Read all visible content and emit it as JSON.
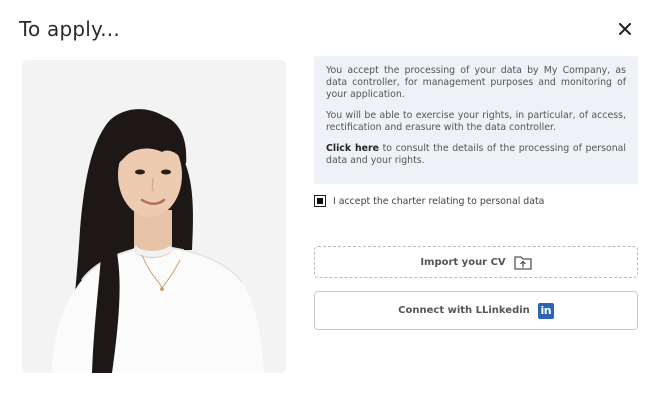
{
  "dialog": {
    "title": "To apply...",
    "close_icon": "close-icon"
  },
  "photo": {
    "subject": "woman-portrait"
  },
  "info": {
    "paragraph1": "You accept the processing of your data by My Company, as data controller, for management purposes and monitoring of your application.",
    "paragraph2": "You will be able to exercise your rights, in particular, of access, rectification and erasure with the data controller.",
    "link_text": "Click here",
    "paragraph3_rest": " to consult the details of the processing of personal data and your rights."
  },
  "consent": {
    "label": "I accept the charter relating to personal data",
    "checked": true
  },
  "actions": {
    "import_cv": "Import your CV",
    "import_icon": "upload-file-icon",
    "linkedin": "Connect with LLinkedin",
    "linkedin_icon": "linkedin-icon",
    "linkedin_glyph": "in",
    "linkedin_color": "#2a66b3"
  }
}
